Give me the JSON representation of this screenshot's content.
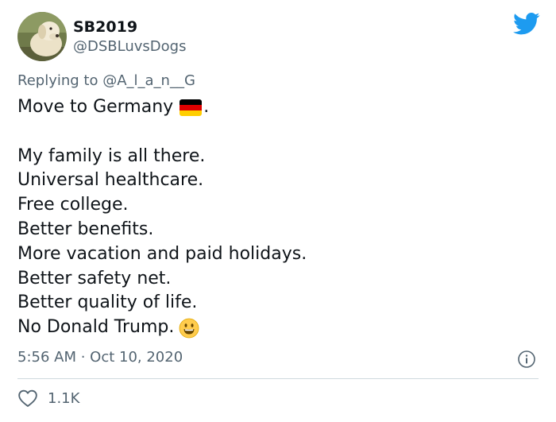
{
  "author": {
    "display_name": "SB2019",
    "handle": "@DSBLuvsDogs"
  },
  "reply": {
    "prefix": "Replying to ",
    "mention": "@A_l_a_n__G"
  },
  "tweet": {
    "line1": "Move to Germany",
    "line1_suffix": ".",
    "flag_emoji": "german-flag",
    "lines": [
      "My family is all there.",
      "Universal healthcare.",
      "Free college.",
      "Better benefits.",
      "More vacation and paid holidays.",
      "Better safety net.",
      "Better quality of life."
    ],
    "last_line": "No Donald Trump.",
    "last_emoji": "grinning-face"
  },
  "meta": {
    "timestamp": "5:56 AM · Oct 10, 2020"
  },
  "engagement": {
    "likes": "1.1K"
  },
  "colors": {
    "twitter_blue": "#1d9bf0",
    "secondary_text": "#536471",
    "divider": "#cfd9de"
  }
}
